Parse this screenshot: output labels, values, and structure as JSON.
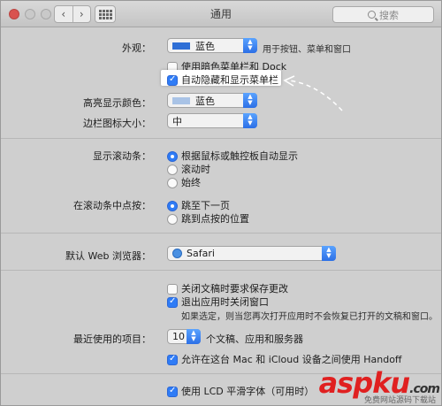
{
  "window": {
    "title": "通用",
    "search_placeholder": "搜索"
  },
  "appearance": {
    "label": "外观：",
    "value": "蓝色",
    "hint": "用于按钮、菜单和窗口",
    "swatch_color": "#2f6fd6"
  },
  "dark_menu": {
    "label": "使用暗色菜单栏和 Dock",
    "checked": false
  },
  "auto_hide": {
    "label": "自动隐藏和显示菜单栏",
    "checked": true
  },
  "highlight_color": {
    "label": "高亮显示颜色：",
    "value": "蓝色",
    "swatch_color": "#a9c3e6"
  },
  "sidebar_icon": {
    "label": "边栏图标大小：",
    "value": "中"
  },
  "scrollbars": {
    "label": "显示滚动条：",
    "options": [
      "根据鼠标或触控板自动显示",
      "滚动时",
      "始终"
    ],
    "selected": 0
  },
  "click_scrollbar": {
    "label": "在滚动条中点按：",
    "options": [
      "跳至下一页",
      "跳到点按的位置"
    ],
    "selected": 0
  },
  "browser": {
    "label": "默认 Web 浏览器：",
    "value": "Safari"
  },
  "ask_save": {
    "label": "关闭文稿时要求保存更改",
    "checked": false
  },
  "close_windows": {
    "label": "退出应用时关闭窗口",
    "checked": true,
    "note": "如果选定，则当您再次打开应用时不会恢复已打开的文稿和窗口。"
  },
  "recent": {
    "label": "最近使用的项目：",
    "value": "10",
    "suffix": "个文稿、应用和服务器"
  },
  "handoff": {
    "label": "允许在这台 Mac 和 iCloud 设备之间使用 Handoff",
    "checked": true
  },
  "lcd": {
    "label": "使用 LCD 平滑字体（可用时）",
    "checked": true
  },
  "watermark": {
    "brand": "aspku",
    "tld": ".com",
    "slogan": "免费网站源码下载站"
  }
}
